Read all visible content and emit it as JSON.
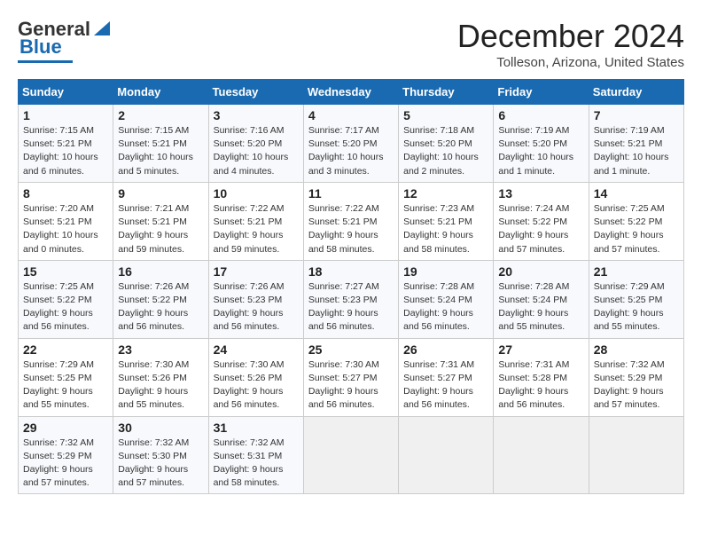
{
  "header": {
    "logo_general": "General",
    "logo_blue": "Blue",
    "month": "December 2024",
    "location": "Tolleson, Arizona, United States"
  },
  "days_of_week": [
    "Sunday",
    "Monday",
    "Tuesday",
    "Wednesday",
    "Thursday",
    "Friday",
    "Saturday"
  ],
  "weeks": [
    [
      {
        "day": "1",
        "sunrise": "7:15 AM",
        "sunset": "5:21 PM",
        "daylight": "10 hours and 6 minutes."
      },
      {
        "day": "2",
        "sunrise": "7:15 AM",
        "sunset": "5:21 PM",
        "daylight": "10 hours and 5 minutes."
      },
      {
        "day": "3",
        "sunrise": "7:16 AM",
        "sunset": "5:20 PM",
        "daylight": "10 hours and 4 minutes."
      },
      {
        "day": "4",
        "sunrise": "7:17 AM",
        "sunset": "5:20 PM",
        "daylight": "10 hours and 3 minutes."
      },
      {
        "day": "5",
        "sunrise": "7:18 AM",
        "sunset": "5:20 PM",
        "daylight": "10 hours and 2 minutes."
      },
      {
        "day": "6",
        "sunrise": "7:19 AM",
        "sunset": "5:20 PM",
        "daylight": "10 hours and 1 minute."
      },
      {
        "day": "7",
        "sunrise": "7:19 AM",
        "sunset": "5:21 PM",
        "daylight": "10 hours and 1 minute."
      }
    ],
    [
      {
        "day": "8",
        "sunrise": "7:20 AM",
        "sunset": "5:21 PM",
        "daylight": "10 hours and 0 minutes."
      },
      {
        "day": "9",
        "sunrise": "7:21 AM",
        "sunset": "5:21 PM",
        "daylight": "9 hours and 59 minutes."
      },
      {
        "day": "10",
        "sunrise": "7:22 AM",
        "sunset": "5:21 PM",
        "daylight": "9 hours and 59 minutes."
      },
      {
        "day": "11",
        "sunrise": "7:22 AM",
        "sunset": "5:21 PM",
        "daylight": "9 hours and 58 minutes."
      },
      {
        "day": "12",
        "sunrise": "7:23 AM",
        "sunset": "5:21 PM",
        "daylight": "9 hours and 58 minutes."
      },
      {
        "day": "13",
        "sunrise": "7:24 AM",
        "sunset": "5:22 PM",
        "daylight": "9 hours and 57 minutes."
      },
      {
        "day": "14",
        "sunrise": "7:25 AM",
        "sunset": "5:22 PM",
        "daylight": "9 hours and 57 minutes."
      }
    ],
    [
      {
        "day": "15",
        "sunrise": "7:25 AM",
        "sunset": "5:22 PM",
        "daylight": "9 hours and 56 minutes."
      },
      {
        "day": "16",
        "sunrise": "7:26 AM",
        "sunset": "5:22 PM",
        "daylight": "9 hours and 56 minutes."
      },
      {
        "day": "17",
        "sunrise": "7:26 AM",
        "sunset": "5:23 PM",
        "daylight": "9 hours and 56 minutes."
      },
      {
        "day": "18",
        "sunrise": "7:27 AM",
        "sunset": "5:23 PM",
        "daylight": "9 hours and 56 minutes."
      },
      {
        "day": "19",
        "sunrise": "7:28 AM",
        "sunset": "5:24 PM",
        "daylight": "9 hours and 56 minutes."
      },
      {
        "day": "20",
        "sunrise": "7:28 AM",
        "sunset": "5:24 PM",
        "daylight": "9 hours and 55 minutes."
      },
      {
        "day": "21",
        "sunrise": "7:29 AM",
        "sunset": "5:25 PM",
        "daylight": "9 hours and 55 minutes."
      }
    ],
    [
      {
        "day": "22",
        "sunrise": "7:29 AM",
        "sunset": "5:25 PM",
        "daylight": "9 hours and 55 minutes."
      },
      {
        "day": "23",
        "sunrise": "7:30 AM",
        "sunset": "5:26 PM",
        "daylight": "9 hours and 55 minutes."
      },
      {
        "day": "24",
        "sunrise": "7:30 AM",
        "sunset": "5:26 PM",
        "daylight": "9 hours and 56 minutes."
      },
      {
        "day": "25",
        "sunrise": "7:30 AM",
        "sunset": "5:27 PM",
        "daylight": "9 hours and 56 minutes."
      },
      {
        "day": "26",
        "sunrise": "7:31 AM",
        "sunset": "5:27 PM",
        "daylight": "9 hours and 56 minutes."
      },
      {
        "day": "27",
        "sunrise": "7:31 AM",
        "sunset": "5:28 PM",
        "daylight": "9 hours and 56 minutes."
      },
      {
        "day": "28",
        "sunrise": "7:32 AM",
        "sunset": "5:29 PM",
        "daylight": "9 hours and 57 minutes."
      }
    ],
    [
      {
        "day": "29",
        "sunrise": "7:32 AM",
        "sunset": "5:29 PM",
        "daylight": "9 hours and 57 minutes."
      },
      {
        "day": "30",
        "sunrise": "7:32 AM",
        "sunset": "5:30 PM",
        "daylight": "9 hours and 57 minutes."
      },
      {
        "day": "31",
        "sunrise": "7:32 AM",
        "sunset": "5:31 PM",
        "daylight": "9 hours and 58 minutes."
      },
      null,
      null,
      null,
      null
    ]
  ],
  "labels": {
    "sunrise": "Sunrise:",
    "sunset": "Sunset:",
    "daylight": "Daylight:"
  }
}
